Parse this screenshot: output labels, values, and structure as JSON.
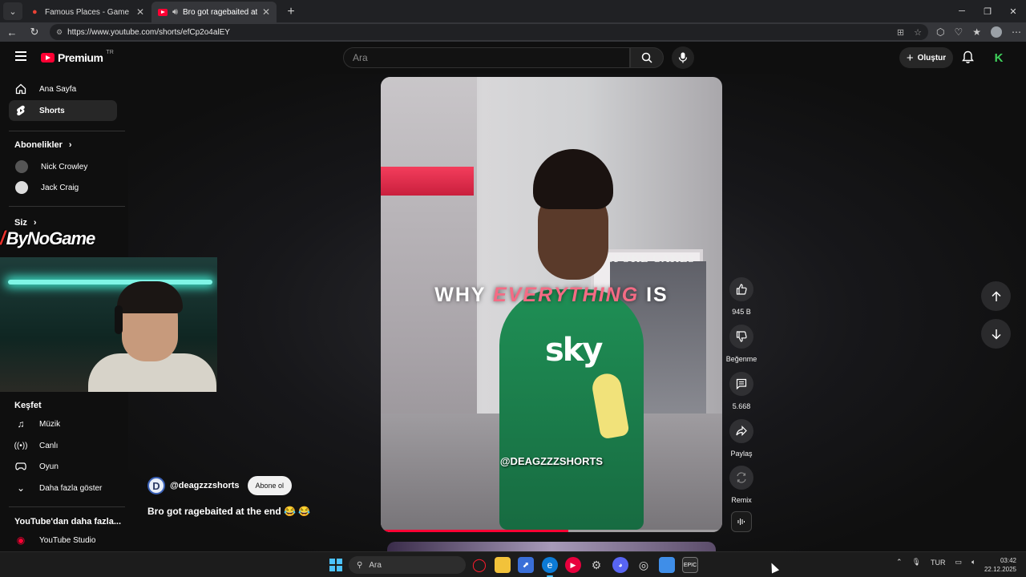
{
  "browser": {
    "tabs": [
      {
        "title": "Famous Places - Game - GeoGuess",
        "active": false
      },
      {
        "title": "Bro got ragebaited at the end",
        "active": true
      }
    ],
    "url": "https://www.youtube.com/shorts/efCp2o4alEY"
  },
  "header": {
    "logo_text": "Premium",
    "logo_region": "TR",
    "search_placeholder": "Ara",
    "create_label": "Oluştur"
  },
  "sidebar": {
    "items": [
      {
        "label": "Ana Sayfa",
        "icon": "home-icon"
      },
      {
        "label": "Shorts",
        "icon": "shorts-icon"
      }
    ],
    "subscriptions_title": "Abonelikler",
    "subscriptions": [
      {
        "label": "Nick Crowley"
      },
      {
        "label": "Jack Craig"
      }
    ],
    "you_title": "Siz",
    "explore_title": "Keşfet",
    "explore": [
      {
        "label": "Müzik",
        "icon": "music-icon"
      },
      {
        "label": "Canlı",
        "icon": "live-icon"
      },
      {
        "label": "Oyun",
        "icon": "gaming-icon"
      },
      {
        "label": "Daha fazla göster",
        "icon": "chevron-down-icon"
      }
    ],
    "more_title": "YouTube'dan daha fazla...",
    "more": [
      {
        "label": "YouTube Studio"
      }
    ]
  },
  "overlay": {
    "streamer_logo": "ByNoGame"
  },
  "short": {
    "caption_plain_1": "WHY ",
    "caption_highlight": "EVERYTHING",
    "caption_plain_2": " IS",
    "watermark": "@DEAGZZZSHORTS",
    "shirt_text": "sky",
    "shop_sign": "SPOKE CAKES",
    "progress": 0.55,
    "channel": "@deagzzzshorts",
    "channel_initial": "D",
    "subscribe_label": "Abone ol",
    "title": "Bro got ragebaited at the end 😂 😂"
  },
  "actions": {
    "like_count": "945 B",
    "dislike_label": "Beğenme",
    "comment_count": "5.668",
    "share_label": "Paylaş",
    "remix_label": "Remix"
  },
  "taskbar": {
    "search_placeholder": "Ara",
    "language": "TUR",
    "time": "03:42",
    "date": "22.12.2025"
  },
  "colors": {
    "accent_red": "#ff0033",
    "caption_highlight": "#f46b84",
    "shirt_green": "#1f8f55"
  }
}
